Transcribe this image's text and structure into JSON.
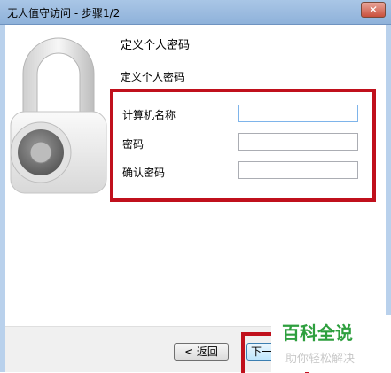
{
  "window": {
    "title": "无人值守访问 - 步骤1/2",
    "close_label": "✕"
  },
  "page": {
    "heading": "定义个人密码",
    "subheading": "定义个人密码"
  },
  "form": {
    "computer_name_label": "计算机名称",
    "computer_name_value": "",
    "password_label": "密码",
    "password_value": "",
    "confirm_password_label": "确认密码",
    "confirm_password_value": ""
  },
  "footer": {
    "back_label": "< 返回",
    "next_label": "下一步"
  },
  "watermark": {
    "brand": "百科全说",
    "tagline": "助你轻松解决"
  },
  "colors": {
    "highlight": "#c0101c",
    "watermark_green": "#2e9f3e"
  }
}
